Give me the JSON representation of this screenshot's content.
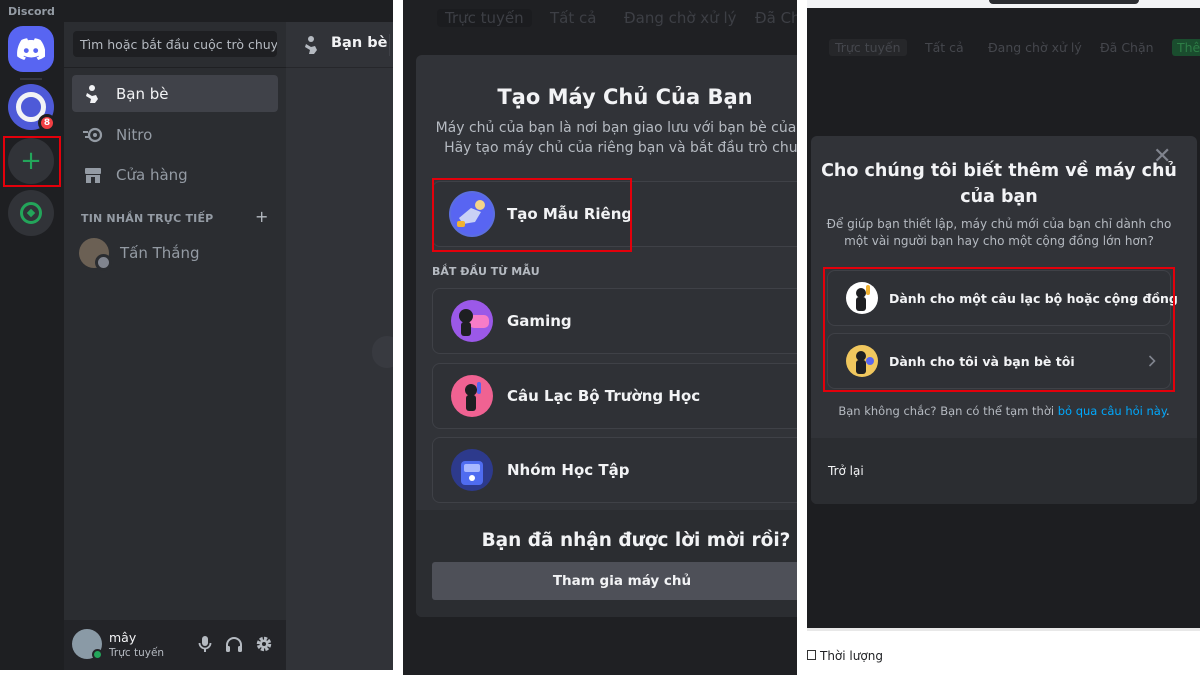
{
  "panel1": {
    "app_title": "Discord",
    "server_badge": "8",
    "search_placeholder": "Tìm hoặc bắt đầu cuộc trò chuyện",
    "nav": [
      {
        "label": "Bạn bè",
        "icon": "friends-icon"
      },
      {
        "label": "Nitro",
        "icon": "nitro-icon"
      },
      {
        "label": "Cửa hàng",
        "icon": "shop-icon"
      }
    ],
    "dm_section": "TIN NHẮN TRỰC TIẾP",
    "dm_add": "+",
    "dm_user": "Tấn Thắng",
    "header_title": "Bạn bè",
    "user": {
      "name": "mây",
      "status": "Trực tuyến"
    }
  },
  "panel2": {
    "tabs": [
      "Trực tuyến",
      "Tất cả",
      "Đang chờ xử lý",
      "Đã Ch"
    ],
    "title": "Tạo Máy Chủ Của Bạn",
    "desc_line1": "Máy chủ của bạn là nơi bạn giao lưu với bạn bè của m",
    "desc_line2": "Hãy tạo máy chủ của riêng bạn và bắt đầu trò chuy",
    "own_template": "Tạo Mẫu Riêng",
    "section": "BẮT ĐẦU TỪ MẪU",
    "templates": [
      "Gaming",
      "Câu Lạc Bộ Trường Học",
      "Nhóm Học Tập"
    ],
    "invite_title": "Bạn đã nhận được lời mời rồi?",
    "join_button": "Tham gia máy chủ"
  },
  "panel3": {
    "tabs": [
      "Trực tuyến",
      "Tất cả",
      "Đang chờ xử lý",
      "Đã Chặn",
      "Thê"
    ],
    "title_line1": "Cho chúng tôi biết thêm về máy chủ",
    "title_line2": "của bạn",
    "desc_line1": "Để giúp bạn thiết lập, máy chủ mới của bạn chỉ dành cho",
    "desc_line2": "một vài người bạn hay cho một cộng đồng lớn hơn?",
    "options": [
      "Dành cho một câu lạc bộ hoặc cộng đồng",
      "Dành cho tôi và bạn bè tôi"
    ],
    "note": "Bạn không chắc? Bạn có thể tạm thời ",
    "note_link": "bỏ qua câu hỏi này",
    "note_end": ".",
    "back": "Trở lại",
    "below_label": "Thời lượng"
  },
  "colors": {
    "blurple": "#5865f2",
    "green": "#23a55a",
    "highlight": "#e3000b",
    "link": "#00a8fc"
  }
}
